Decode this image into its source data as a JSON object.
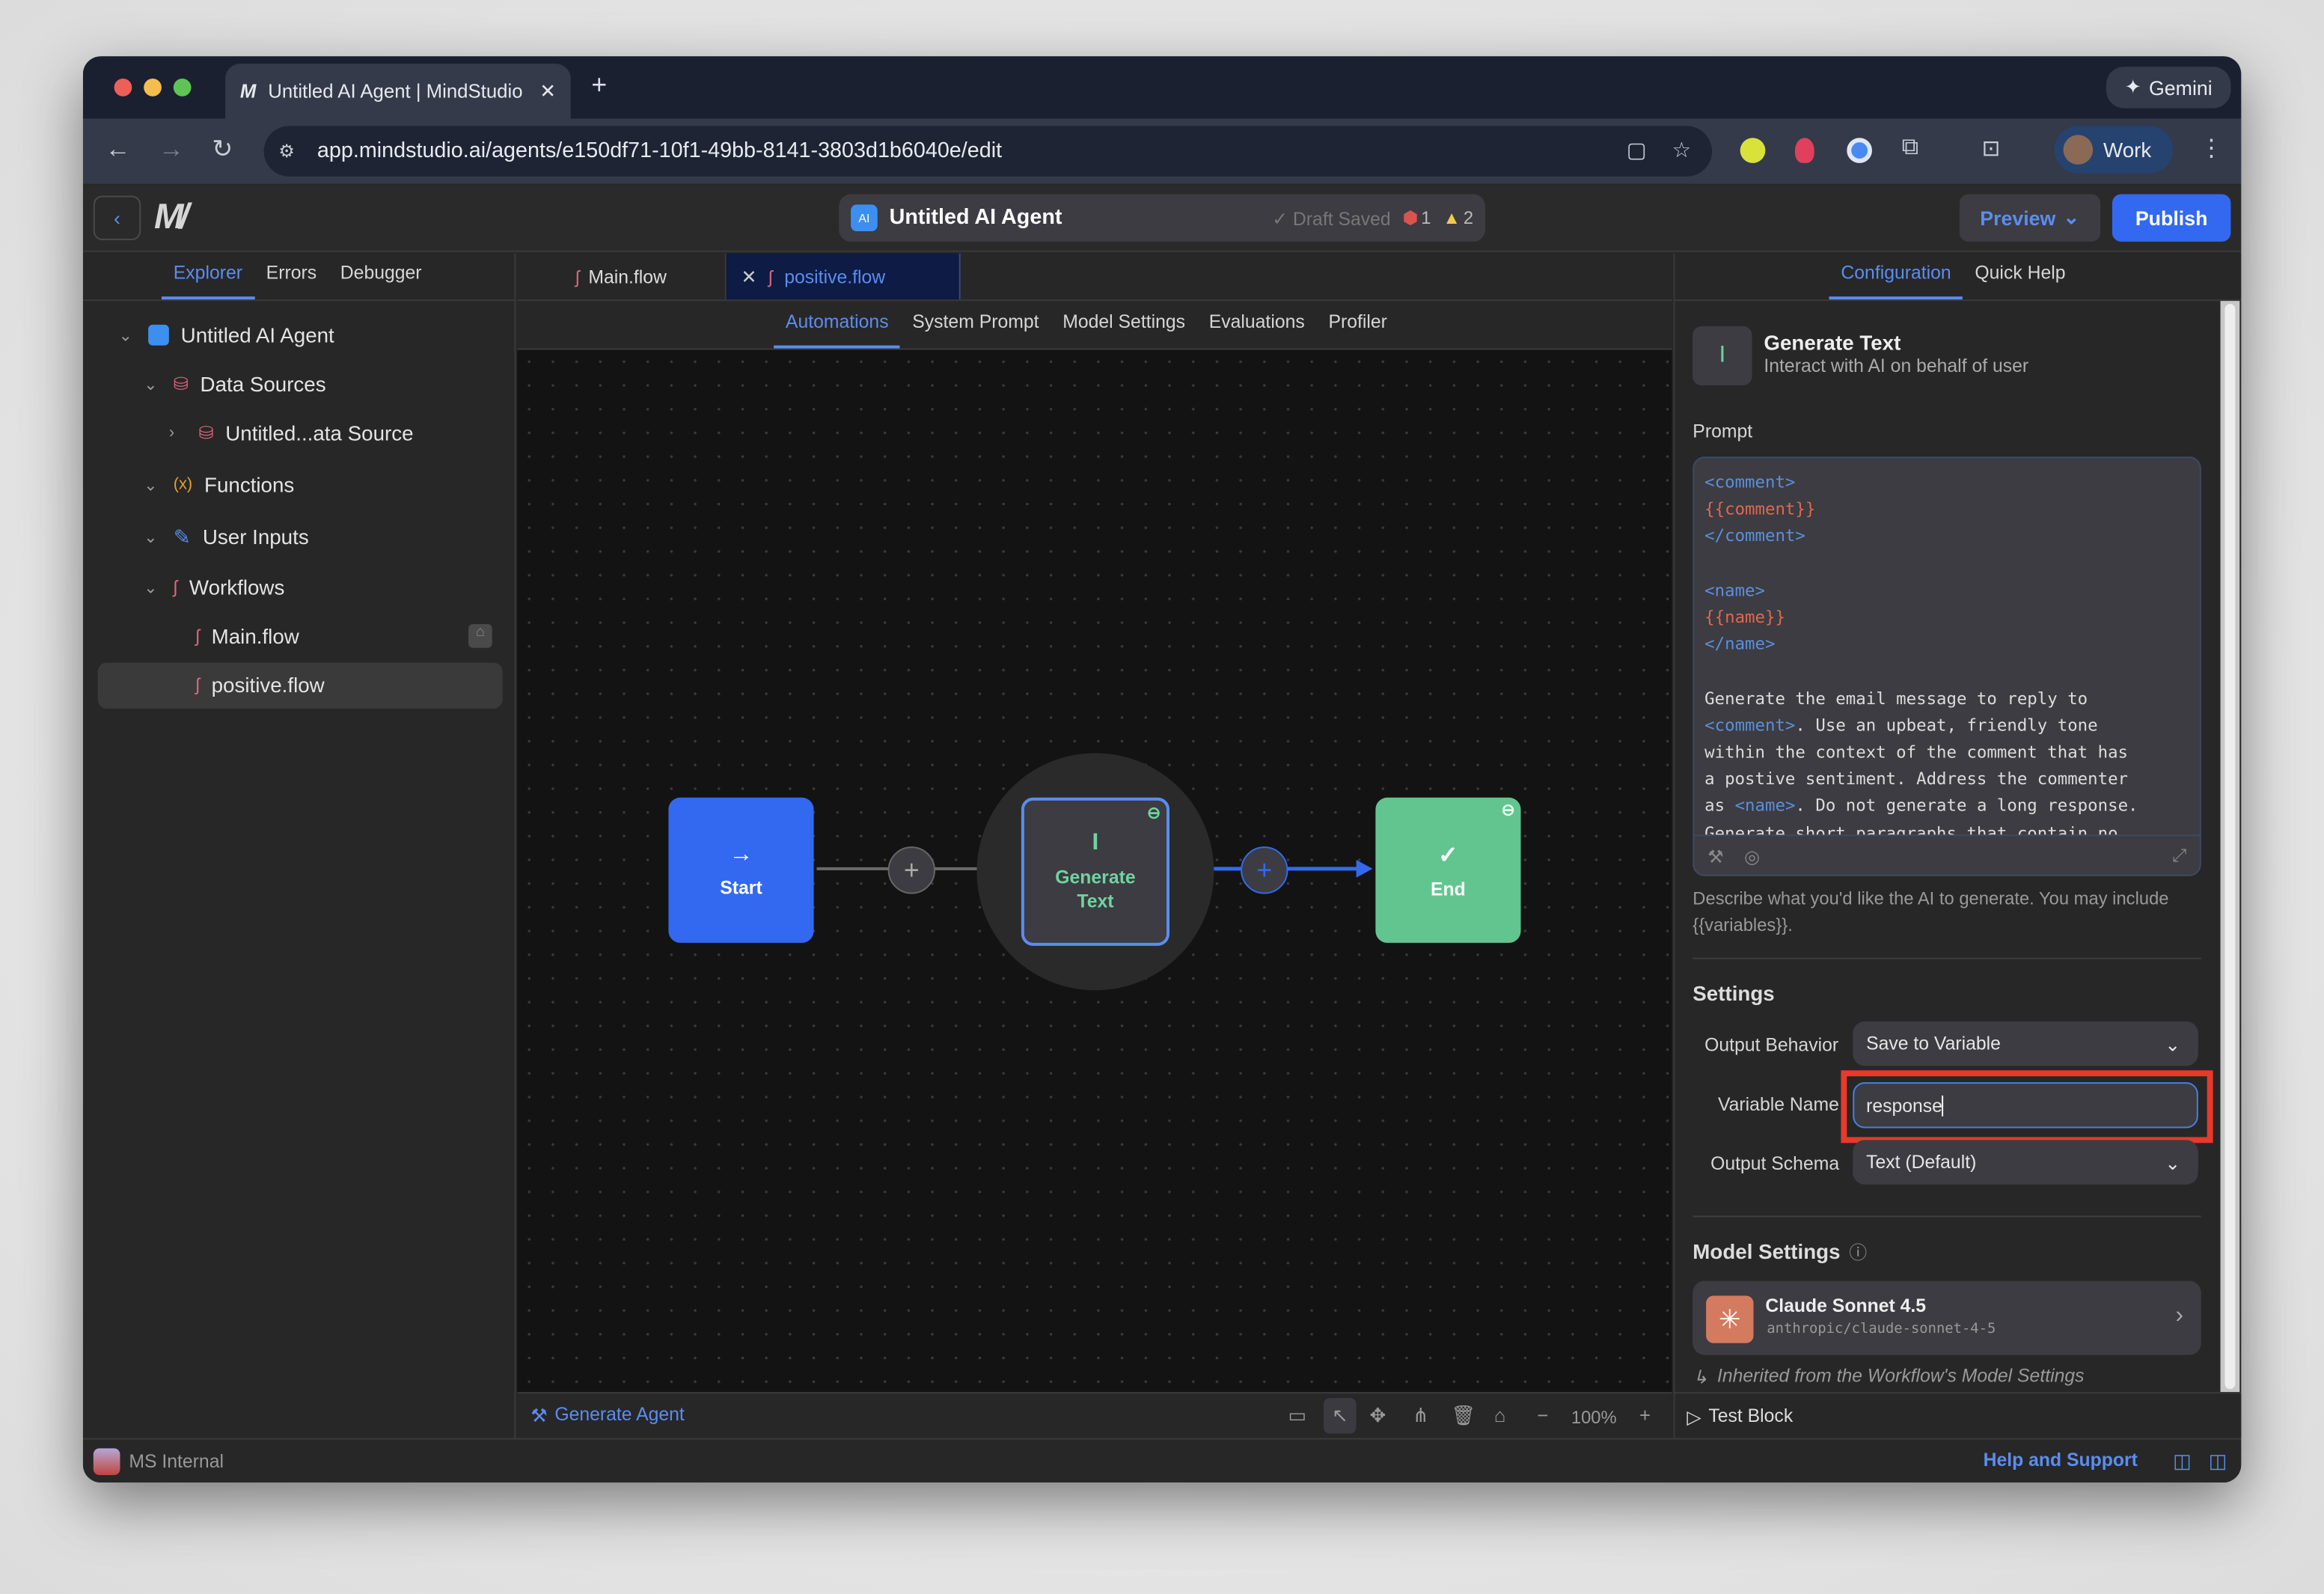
{
  "browser": {
    "tab_title": "Untitled AI Agent | MindStudio",
    "url": "app.mindstudio.ai/agents/e150df71-10f1-49bb-8141-3803d1b6040e/edit",
    "gemini_label": "Gemini",
    "profile_label": "Work"
  },
  "header": {
    "agent_badge": "AI",
    "agent_name": "Untitled AI Agent",
    "draft_status": "✓ Draft Saved",
    "error_count": "1",
    "warning_count": "2",
    "preview_label": "Preview",
    "publish_label": "Publish"
  },
  "sidebar": {
    "tabs": [
      "Explorer",
      "Errors",
      "Debugger"
    ],
    "tree": {
      "root": "Untitled AI Agent",
      "data_sources": "Data Sources",
      "data_source_item": "Untitled...ata Source",
      "functions": "Functions",
      "user_inputs": "User Inputs",
      "workflows": "Workflows",
      "main_flow": "Main.flow",
      "positive_flow": "positive.flow"
    }
  },
  "editor": {
    "file_tabs": [
      "Main.flow",
      "positive.flow"
    ],
    "subtabs": [
      "Automations",
      "System Prompt",
      "Model Settings",
      "Evaluations",
      "Profiler"
    ],
    "nodes": {
      "start": "Start",
      "generate": "Generate Text",
      "end": "End"
    },
    "footer": {
      "generate_agent": "Generate Agent",
      "zoom": "100%"
    }
  },
  "panel": {
    "tabs": [
      "Configuration",
      "Quick Help"
    ],
    "block_title": "Generate Text",
    "block_subtitle": "Interact with AI on behalf of user",
    "prompt_label": "Prompt",
    "prompt_lines": [
      "<comment>",
      "{{comment}}",
      "</comment>",
      "",
      "<name>",
      "{{name}}",
      "</name>",
      "",
      "Generate the email message to reply to",
      "<comment>",
      ". Use an upbeat, friendly tone",
      "within the context of the comment that has",
      "a postive sentiment. Address the commenter",
      "as ",
      "<name>",
      ". Do not generate a long response.",
      "Generate short paragraphs that contain no"
    ],
    "prompt_hint": "Describe what you'd like the AI to generate. You may include {{variables}}.",
    "settings_title": "Settings",
    "output_behavior_label": "Output Behavior",
    "output_behavior_value": "Save to Variable",
    "variable_name_label": "Variable Name",
    "variable_name_value": "response",
    "output_schema_label": "Output Schema",
    "output_schema_value": "Text (Default)",
    "model_settings_title": "Model Settings",
    "model_name": "Claude Sonnet 4.5",
    "model_id": "anthropic/claude-sonnet-4-5",
    "inherited_note": "Inherited from the Workflow's Model Settings",
    "test_block": "Test Block"
  },
  "status": {
    "workspace": "MS Internal",
    "help": "Help and Support"
  },
  "colors": {
    "accent": "#3369f0",
    "end_green": "#62c58f",
    "highlight": "#e8392a"
  }
}
